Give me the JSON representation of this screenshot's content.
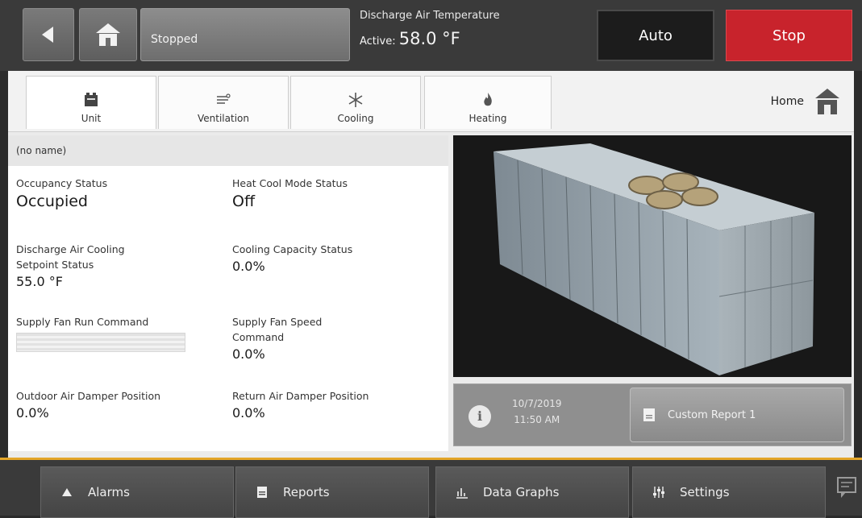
{
  "header": {
    "status": "Stopped",
    "discharge_label": "Discharge Air Temperature",
    "active_prefix": "Active",
    "active_value": "58.0 °F",
    "auto_label": "Auto",
    "stop_label": "Stop"
  },
  "tabs": [
    {
      "label": "Unit",
      "icon": "unit-icon"
    },
    {
      "label": "Ventilation",
      "icon": "ventilation-icon"
    },
    {
      "label": "Cooling",
      "icon": "cooling-icon"
    },
    {
      "label": "Heating",
      "icon": "heating-icon"
    }
  ],
  "home": {
    "label": "Home",
    "icon": "home-icon"
  },
  "unit_name": "(no name)",
  "points": {
    "occupancy": {
      "label": "Occupancy Status",
      "value": "Occupied"
    },
    "heat_cool": {
      "label": "Heat Cool Mode Status",
      "value": "Off"
    },
    "da_cooling": {
      "label_1": "Discharge Air Cooling",
      "label_2": "Setpoint Status",
      "value": "55.0 °F"
    },
    "cool_cap": {
      "label": "Cooling Capacity Status",
      "value": "0.0%"
    },
    "fan_run": {
      "label": "Supply Fan Run Command",
      "value": ""
    },
    "fan_speed": {
      "label_1": "Supply Fan Speed",
      "label_2": "Command",
      "value": "0.0%"
    },
    "oa_damper": {
      "label": "Outdoor Air Damper Position",
      "value": "0.0%"
    },
    "ra_damper": {
      "label": "Return Air Damper Position",
      "value": "0.0%"
    }
  },
  "info": {
    "date": "10/7/2019",
    "time": "11:50 AM",
    "report_label": "Custom Report 1"
  },
  "nav": {
    "alarms": "Alarms",
    "reports": "Reports",
    "graphs": "Data Graphs",
    "settings": "Settings"
  },
  "colors": {
    "stop": "#c8232c",
    "accent_line": "#e3a528"
  }
}
